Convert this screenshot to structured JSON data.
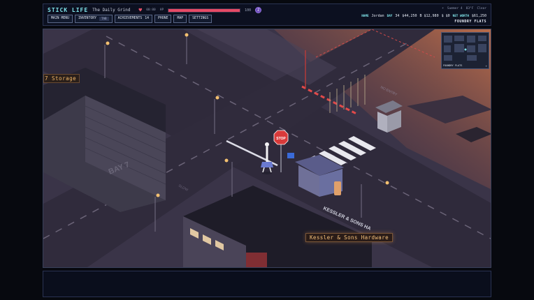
{
  "hud": {
    "title": "STICK LIFE",
    "subtitle": "The Daily Grind",
    "clock": "00:00",
    "hp_prefix": "HP",
    "hp_current": 100,
    "hp_max": 100,
    "hp_max_label": "100",
    "energy_label": "Z",
    "buttons": {
      "main_menu": "MAIN MENU",
      "inventory": "INVENTORY",
      "inventory_badge": "TAB",
      "achievements": "ACHIEVEMENTS",
      "achievements_count": "14",
      "phone": "PHONE",
      "map": "MAP",
      "settings": "SETTINGS"
    },
    "weather": {
      "season": "Summer 4",
      "temp": "83°F",
      "condition": "Clear"
    },
    "stats": {
      "name_key": "NAME",
      "name": "Jordan",
      "day_key": "DAY",
      "day": "34",
      "cash": "$44,250",
      "bank": "B $12,980",
      "debt": "$ $0",
      "networth_key": "NET WORTH",
      "networth": "$61,250"
    },
    "location": "FOUNDRY FLATS"
  },
  "scene": {
    "storage_sign": "7 Storage",
    "bay_label": "BAY 7",
    "kessler_sign": "Kessler & Sons Hardware",
    "kessler_roof_sign": "KESSLER & SONS HA",
    "stop_sign": "STOP",
    "no_entry": "NO ENTRY",
    "road_marking": "SLOW",
    "minimap_label": "FOUNDRY FLATS",
    "minimap_expand": "+"
  },
  "colors": {
    "accent": "#7fe3e9",
    "health": "#e64a66",
    "sign_text": "#f4c07a"
  }
}
